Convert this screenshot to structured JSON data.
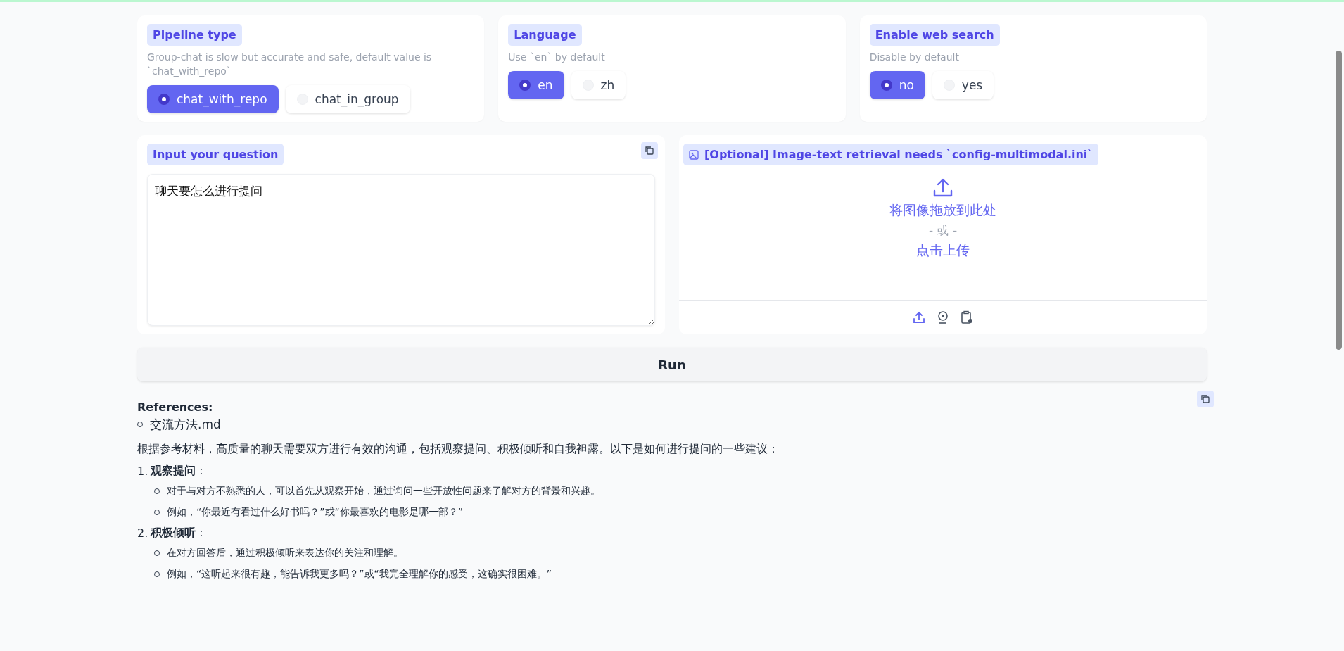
{
  "option_groups": [
    {
      "label": "Pipeline type",
      "info": "Group-chat is slow but accurate and safe, default value is `chat_with_repo`",
      "options": [
        {
          "label": "chat_with_repo",
          "selected": true
        },
        {
          "label": "chat_in_group",
          "selected": false
        }
      ]
    },
    {
      "label": "Language",
      "info": "Use `en` by default",
      "options": [
        {
          "label": "en",
          "selected": true
        },
        {
          "label": "zh",
          "selected": false
        }
      ]
    },
    {
      "label": "Enable web search",
      "info": "Disable by default",
      "options": [
        {
          "label": "no",
          "selected": true
        },
        {
          "label": "yes",
          "selected": false
        }
      ]
    }
  ],
  "question": {
    "label": "Input your question",
    "value": "聊天要怎么进行提问"
  },
  "image_input": {
    "label": "[Optional] Image-text retrieval needs `config-multimodal.ini`",
    "drop_text": "将图像拖放到此处",
    "or_text": "- 或 -",
    "click_text": "点击上传"
  },
  "run_button": "Run",
  "answer": {
    "references_label": "References:",
    "references": [
      "交流方法.md"
    ],
    "intro": "根据参考材料，高质量的聊天需要双方进行有效的沟通，包括观察提问、积极倾听和自我袒露。以下是如何进行提问的一些建议：",
    "points": [
      {
        "number": "1.",
        "title": "**观察提问**：",
        "bullets": [
          "对于与对方不熟悉的人，可以首先从观察开始，通过询问一些开放性问题来了解对方的背景和兴趣。",
          "例如，“你最近有看过什么好书吗？”或“你最喜欢的电影是哪一部？”"
        ]
      },
      {
        "number": "2.",
        "title": "**积极倾听**：",
        "bullets": [
          "在对方回答后，通过积极倾听来表达你的关注和理解。",
          "例如，“这听起来很有趣，能告诉我更多吗？”或“我完全理解你的感受，这确实很困难。”"
        ]
      }
    ]
  }
}
